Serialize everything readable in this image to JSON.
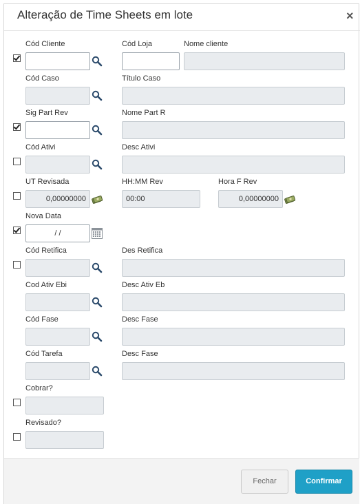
{
  "dialog": {
    "title": "Alteração de Time Sheets em lote",
    "close_glyph": "×"
  },
  "fields": {
    "cod_cliente": {
      "label": "Cód Cliente",
      "value": "",
      "checked": true
    },
    "cod_loja": {
      "label": "Cód Loja",
      "value": ""
    },
    "nome_cliente": {
      "label": "Nome cliente",
      "value": ""
    },
    "cod_caso": {
      "label": "Cód Caso",
      "value": ""
    },
    "titulo_caso": {
      "label": "Título Caso",
      "value": ""
    },
    "sig_part_rev": {
      "label": "Sig Part Rev",
      "value": "",
      "checked": true
    },
    "nome_part_r": {
      "label": "Nome Part R",
      "value": ""
    },
    "cod_ativi": {
      "label": "Cód Ativi",
      "value": "",
      "checked": false
    },
    "desc_ativi": {
      "label": "Desc Ativi",
      "value": ""
    },
    "ut_revisada": {
      "label": "UT Revisada",
      "value": "0,00000000",
      "checked": false
    },
    "hhmm_rev": {
      "label": "HH:MM Rev",
      "value": "00:00"
    },
    "hora_f_rev": {
      "label": "Hora F Rev",
      "value": "0,00000000"
    },
    "nova_data": {
      "label": "Nova Data",
      "value": "/  /",
      "checked": true
    },
    "cod_retifica": {
      "label": "Cód Retifica",
      "value": "",
      "checked": false
    },
    "des_retifica": {
      "label": "Des Retifica",
      "value": ""
    },
    "cod_ativ_ebi": {
      "label": "Cod Ativ Ebi",
      "value": ""
    },
    "desc_ativ_eb": {
      "label": "Desc Ativ Eb",
      "value": ""
    },
    "cod_fase": {
      "label": "Cód Fase",
      "value": ""
    },
    "desc_fase": {
      "label": "Desc Fase",
      "value": ""
    },
    "cod_tarefa": {
      "label": "Cód Tarefa",
      "value": ""
    },
    "desc_fase_2": {
      "label": "Desc Fase",
      "value": ""
    },
    "cobrar": {
      "label": "Cobrar?",
      "value": "",
      "checked": false
    },
    "revisado": {
      "label": "Revisado?",
      "value": "",
      "checked": false
    }
  },
  "icons": {
    "lookup": "search-icon",
    "money": "money-icon",
    "calendar": "calendar-icon"
  },
  "buttons": {
    "cancel_label": "Fechar",
    "confirm_label": "Confirmar"
  },
  "colors": {
    "primary": "#1fa0c7",
    "disabled_field": "#e9ecef"
  }
}
